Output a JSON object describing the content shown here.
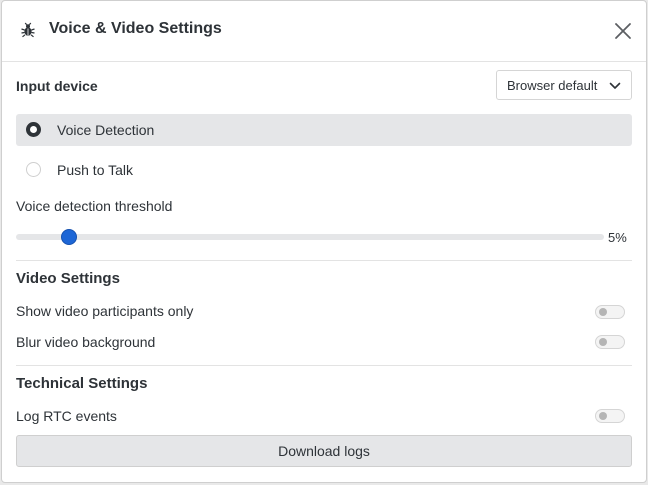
{
  "modal": {
    "title": "Voice & Video Settings",
    "header_icon": "bug-icon",
    "close_icon": "close-icon"
  },
  "input_device": {
    "label": "Input device",
    "selected": "Browser default",
    "dropdown_icon": "chevron-down-icon"
  },
  "input_mode": {
    "options": [
      {
        "label": "Voice Detection",
        "selected": true
      },
      {
        "label": "Push to Talk",
        "selected": false
      }
    ]
  },
  "threshold": {
    "label": "Voice detection threshold",
    "value_text": "5%",
    "value": 5,
    "min": 0,
    "max": 100
  },
  "video_settings": {
    "title": "Video Settings",
    "items": [
      {
        "label": "Show video participants only",
        "enabled": false
      },
      {
        "label": "Blur video background",
        "enabled": false
      }
    ]
  },
  "technical_settings": {
    "title": "Technical Settings",
    "items": [
      {
        "label": "Log RTC events",
        "enabled": false
      }
    ],
    "download_label": "Download logs"
  },
  "colors": {
    "accent": "#1d66d6",
    "selected_row_bg": "#e5e6e8"
  }
}
